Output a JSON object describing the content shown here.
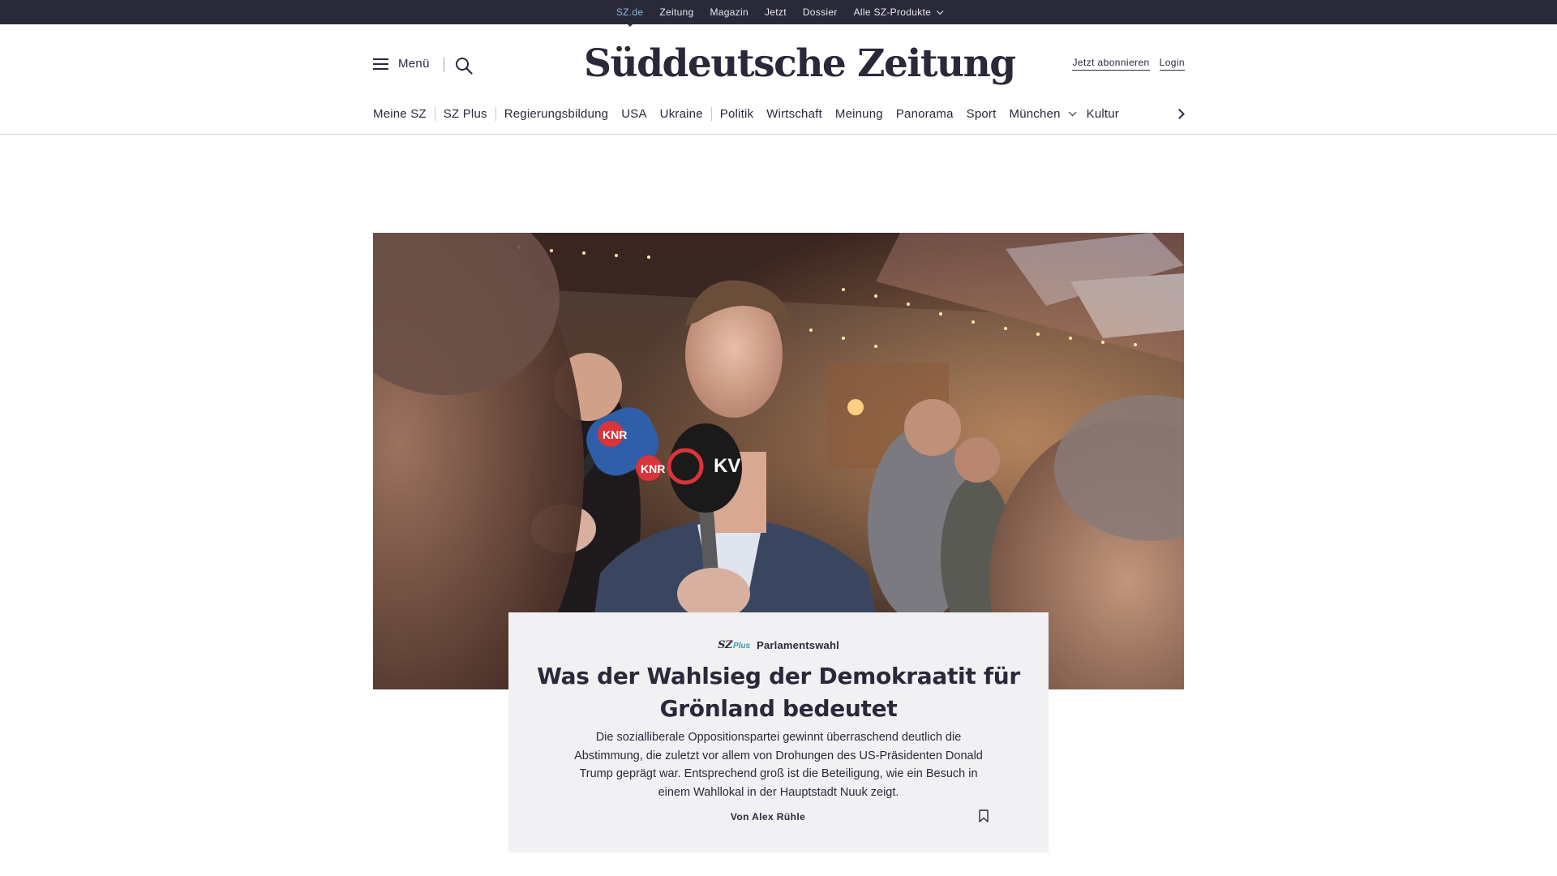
{
  "topbar": {
    "links": [
      "SZ.de",
      "Zeitung",
      "Magazin",
      "Jetzt",
      "Dossier",
      "Alle SZ-Produkte"
    ],
    "active": "SZ.de"
  },
  "header": {
    "menu_label": "Menü",
    "logo_text": "Süddeutsche Zeitung",
    "subscribe_label": "Jetzt abonnieren",
    "login_label": "Login",
    "icons": [
      "hamburger-icon",
      "search-icon"
    ]
  },
  "nav": {
    "items": [
      "Meine SZ",
      "SZ Plus",
      "Regierungsbildung",
      "USA",
      "Ukraine",
      "Politik",
      "Wirtschaft",
      "Meinung",
      "Panorama",
      "Sport",
      "München",
      "Kultur"
    ]
  },
  "teaser": {
    "badge_sz": "SZ",
    "badge_plus": "Plus",
    "kicker": "Parlamentswahl",
    "headline": "Was der Wahlsieg der Demokraatit für Grönland bedeutet",
    "summary": "Die sozialliberale Oppositionspartei gewinnt überraschend deutlich die Abstimmung, die zuletzt vor allem von Drohungen des US-Präsidenten Donald Trump geprägt war. Entsprechend groß ist die Beteiligung, wie ein Besuch in einem Wahllokal in der Hauptstadt Nuuk zeigt.",
    "author": "Von Alex Rühle"
  },
  "hero_image": {
    "mic_labels": [
      "KNR",
      "KNR",
      "KV"
    ]
  },
  "colors": {
    "brand_dark": "#29293a",
    "accent_teal": "#3a9aa8",
    "card_bg": "#f1f1f3",
    "active_link": "#8fb6d9"
  }
}
